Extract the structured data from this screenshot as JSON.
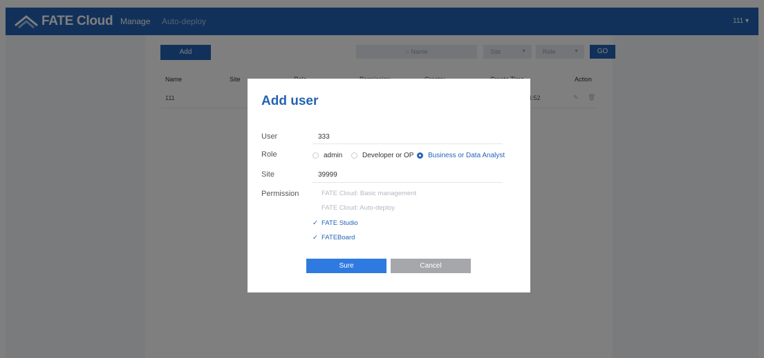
{
  "header": {
    "brand": "FATE Cloud",
    "nav": [
      "Manage",
      "Auto-deploy"
    ],
    "user_menu": "111 ▾"
  },
  "toolbar": {
    "add_label": "Add",
    "search_placeholder": "Name",
    "site_select": "Site",
    "role_select": "Role",
    "go_label": "GO"
  },
  "table": {
    "columns": [
      "Name",
      "Site",
      "Role",
      "Permission",
      "Creator",
      "Create Time",
      "Action"
    ],
    "rows": [
      {
        "name": "111",
        "create_time_tail": "4:52"
      }
    ]
  },
  "modal": {
    "title": "Add user",
    "user_label": "User",
    "user_value": "333",
    "role_label": "Role",
    "role_options": [
      "admin",
      "Developer or OP",
      "Business or Data Analyst"
    ],
    "role_selected": "Business or Data Analyst",
    "site_label": "Site",
    "site_value": "39999",
    "permission_label": "Permission",
    "permissions": [
      {
        "label": "FATE Cloud: Basic management",
        "checked": false
      },
      {
        "label": "FATE Cloud: Auto-deploy",
        "checked": false
      },
      {
        "label": "FATE Studio",
        "checked": true
      },
      {
        "label": "FATEBoard",
        "checked": true
      }
    ],
    "sure_label": "Sure",
    "cancel_label": "Cancel"
  },
  "colors": {
    "primary": "#2463b5",
    "sure_button": "#2f7ae0",
    "cancel_button": "#a5a7ab"
  }
}
